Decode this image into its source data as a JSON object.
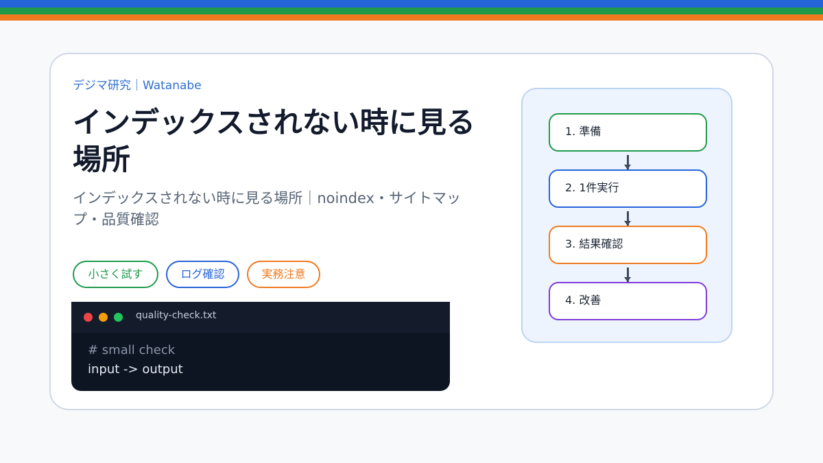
{
  "colors": {
    "stripe_blue": "#2563d9",
    "stripe_green": "#1f9a4b",
    "stripe_orange": "#f07a1f"
  },
  "eyebrow": "デジマ研究｜Watanabe",
  "title": "インデックスされない時に見る場所",
  "subtitle": "インデックスされない時に見る場所｜noindex・サイトマップ・品質確認",
  "tags": [
    {
      "label": "小さく試す",
      "color": "#1f9a4b"
    },
    {
      "label": "ログ確認",
      "color": "#2563d9"
    },
    {
      "label": "実務注意",
      "color": "#f07a1f"
    }
  ],
  "code": {
    "filename": "quality-check.txt",
    "dots": [
      "#ef4444",
      "#f59e0b",
      "#22c55e"
    ],
    "lines": [
      {
        "text": "# small check",
        "color": "#8b96a8"
      },
      {
        "text": "input -> output",
        "color": "#e6ebf2"
      }
    ]
  },
  "steps": [
    {
      "label": "1. 準備",
      "color": "#1f9a4b"
    },
    {
      "label": "2. 1件実行",
      "color": "#2563d9"
    },
    {
      "label": "3. 結果確認",
      "color": "#f07a1f"
    },
    {
      "label": "4. 改善",
      "color": "#7e3bd6"
    }
  ]
}
